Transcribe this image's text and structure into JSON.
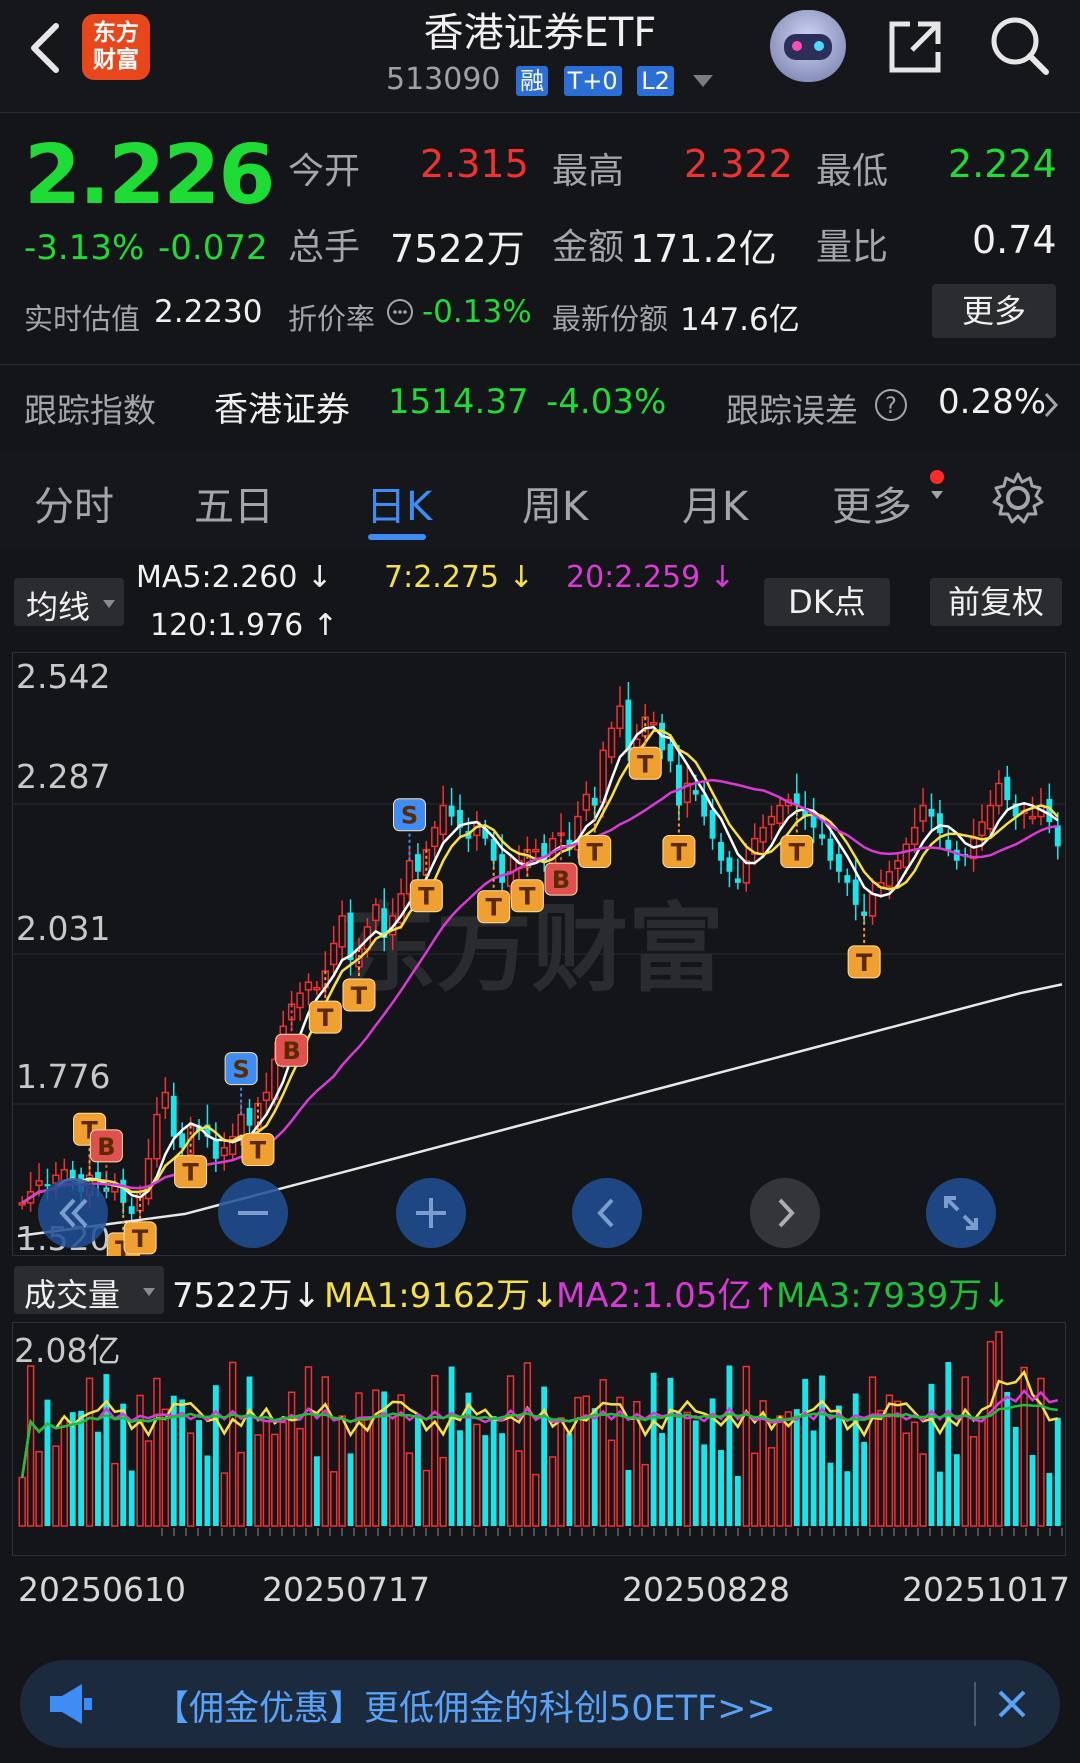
{
  "header": {
    "title": "香港证券ETF",
    "code": "513090",
    "tags": [
      "融",
      "T+0",
      "L2"
    ],
    "logo_text": [
      "东方",
      "财富"
    ]
  },
  "quote": {
    "price": "2.226",
    "change_pct": "-3.13%",
    "change": "-0.072",
    "open_label": "今开",
    "open": "2.315",
    "high_label": "最高",
    "high": "2.322",
    "low_label": "最低",
    "low": "2.224",
    "volume_label": "总手",
    "volume": "7522万",
    "amount_label": "金额",
    "amount": "171.2亿",
    "ratio_label": "量比",
    "ratio": "0.74",
    "iopv_label": "实时估值",
    "iopv": "2.2230",
    "discount_label": "折价率",
    "discount": "-0.13%",
    "shares_label": "最新份额",
    "shares": "147.6亿",
    "more_label": "更多"
  },
  "tracking": {
    "label": "跟踪指数",
    "index_name": "香港证券",
    "index_value": "1514.37",
    "index_change": "-4.03%",
    "error_label": "跟踪误差",
    "error_value": "0.28%"
  },
  "tabs": [
    "分时",
    "五日",
    "日K",
    "周K",
    "月K",
    "更多"
  ],
  "active_tab": "日K",
  "ma_info": {
    "selector": "均线",
    "ma5": "MA5:2.260",
    "ma7": "7:2.275",
    "ma20": "20:2.259",
    "ma120": "120:1.976",
    "dk_label": "DK点",
    "adjust_label": "前复权"
  },
  "volume_info": {
    "selector": "成交量",
    "volume": "7522万",
    "ma1": "MA1:9162万",
    "ma2": "MA2:1.05亿",
    "ma3": "MA3:7939万",
    "max_label": "2.08亿"
  },
  "watermark": "东方财富",
  "banner": {
    "text": "【佣金优惠】更低佣金的科创50ETF>>"
  },
  "colors": {
    "up": "#f23030",
    "down": "#18e6ea",
    "ma5": "#ffffff",
    "ma7": "#f5e04a",
    "ma20": "#d93ad6",
    "ma120": "#e8e8e8",
    "accent": "#3d8df5"
  },
  "chart_data": {
    "type": "candlestick",
    "y_ticks": [
      "2.542",
      "2.287",
      "2.031",
      "1.776",
      "1.520"
    ],
    "x_ticks": [
      "20250610",
      "20250717",
      "20250828",
      "20251017"
    ],
    "ylim": [
      1.52,
      2.542
    ],
    "close": [
      1.58,
      1.6,
      1.62,
      1.61,
      1.63,
      1.64,
      1.62,
      1.6,
      1.63,
      1.62,
      1.6,
      1.61,
      1.58,
      1.56,
      1.6,
      1.66,
      1.74,
      1.78,
      1.7,
      1.68,
      1.72,
      1.71,
      1.7,
      1.66,
      1.68,
      1.7,
      1.74,
      1.72,
      1.76,
      1.78,
      1.84,
      1.9,
      1.94,
      1.96,
      1.98,
      1.97,
      2.0,
      2.05,
      2.1,
      2.02,
      2.04,
      2.08,
      2.12,
      2.06,
      2.1,
      2.14,
      2.2,
      2.18,
      2.22,
      2.26,
      2.3,
      2.28,
      2.26,
      2.24,
      2.27,
      2.24,
      2.2,
      2.16,
      2.18,
      2.2,
      2.22,
      2.22,
      2.2,
      2.24,
      2.25,
      2.22,
      2.28,
      2.32,
      2.3,
      2.4,
      2.44,
      2.48,
      2.4,
      2.42,
      2.46,
      2.45,
      2.4,
      2.38,
      2.3,
      2.34,
      2.32,
      2.28,
      2.24,
      2.2,
      2.18,
      2.16,
      2.2,
      2.24,
      2.26,
      2.28,
      2.3,
      2.31,
      2.3,
      2.28,
      2.26,
      2.24,
      2.2,
      2.18,
      2.16,
      2.12,
      2.1,
      2.14,
      2.16,
      2.18,
      2.2,
      2.23,
      2.26,
      2.3,
      2.28,
      2.25,
      2.22,
      2.2,
      2.21,
      2.24,
      2.27,
      2.3,
      2.34,
      2.31,
      2.28,
      2.29,
      2.28,
      2.3,
      2.27,
      2.226
    ],
    "ma120": [
      1.52,
      1.53,
      1.54,
      1.55,
      1.56,
      1.58,
      1.6,
      1.62,
      1.64,
      1.66,
      1.68,
      1.7,
      1.72,
      1.74,
      1.76,
      1.78,
      1.8,
      1.82,
      1.84,
      1.86,
      1.88,
      1.9,
      1.92,
      1.94,
      1.96,
      1.976
    ]
  }
}
